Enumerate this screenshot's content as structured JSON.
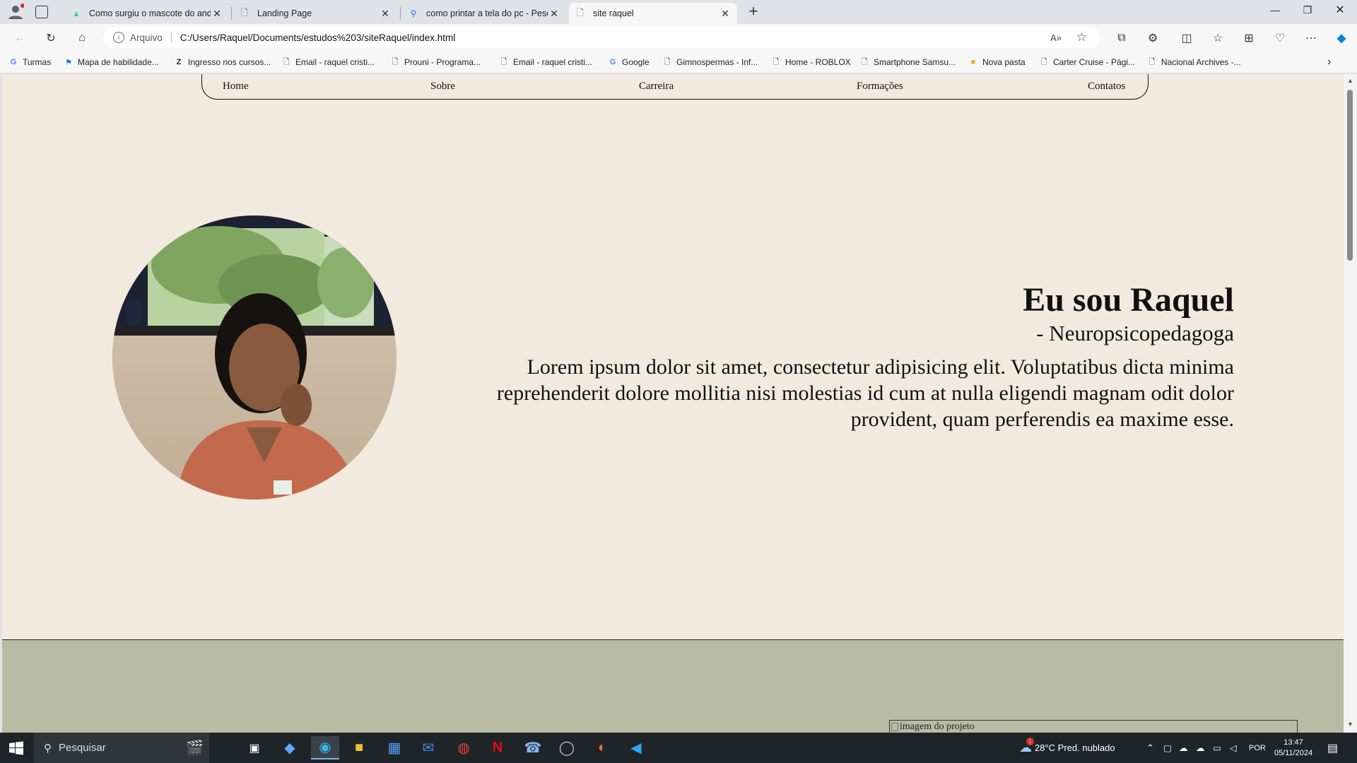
{
  "browser": {
    "tabs": [
      {
        "title": "Como surgiu o mascote do andro",
        "icon": "android-icon",
        "active": false
      },
      {
        "title": "Landing Page",
        "icon": "page-icon",
        "active": false
      },
      {
        "title": "como printar a tela do pc - Pesqu",
        "icon": "search-icon",
        "active": false
      },
      {
        "title": "site raquel",
        "icon": "page-icon",
        "active": true
      }
    ],
    "address": {
      "scheme_label": "Arquivo",
      "url": "C:/Users/Raquel/Documents/estudos%203/siteRaquel/index.html"
    },
    "bookmarks": [
      {
        "label": "Turmas",
        "icon": "google-icon"
      },
      {
        "label": "Mapa de habilidade...",
        "icon": "map-icon"
      },
      {
        "label": "Ingresso nos cursos...",
        "icon": "z-icon"
      },
      {
        "label": "Email - raquel cristi...",
        "icon": "page-icon"
      },
      {
        "label": "Prouni - Programa...",
        "icon": "page-icon"
      },
      {
        "label": "Email - raquel cristi...",
        "icon": "page-icon"
      },
      {
        "label": "Google",
        "icon": "google-icon"
      },
      {
        "label": "Gimnospermas - Inf...",
        "icon": "page-icon"
      },
      {
        "label": "Home - ROBLOX",
        "icon": "page-icon"
      },
      {
        "label": "Smartphone Samsu...",
        "icon": "page-icon"
      },
      {
        "label": "Nova pasta",
        "icon": "folder-icon"
      },
      {
        "label": "Carter Cruise - Pági...",
        "icon": "page-icon"
      },
      {
        "label": "Nacional Archives -...",
        "icon": "page-icon"
      }
    ]
  },
  "page": {
    "nav": [
      "Home",
      "Sobre",
      "Carreira",
      "Formações",
      "Contatos"
    ],
    "hero": {
      "title": "Eu sou Raquel",
      "subtitle": "- Neuropsicopedagoga",
      "text": "Lorem ipsum dolor sit amet, consectetur adipisicing elit. Voluptatibus dicta minima reprehenderit dolore mollitia nisi molestias id cum at nulla eligendi magnam odit dolor provident, quam perferendis ea maxime esse."
    },
    "project_image_alt": "imagem do projeto"
  },
  "taskbar": {
    "search_placeholder": "Pesquisar",
    "weather": "28°C  Pred. nublado",
    "weather_badge": "1",
    "language": "POR",
    "time": "13:47",
    "date": "05/11/2024"
  },
  "colors": {
    "page_bg": "#f3eadf",
    "section2_bg": "#b8bca2",
    "taskbar_bg": "#1f2429"
  }
}
